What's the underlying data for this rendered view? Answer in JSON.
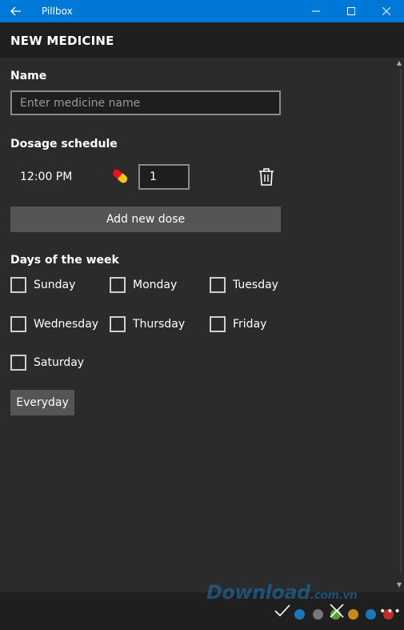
{
  "window": {
    "title": "Pillbox",
    "back_icon": "back-arrow-icon",
    "minimize_icon": "minimize-icon",
    "maximize_icon": "maximize-icon",
    "close_icon": "close-icon",
    "accent_color": "#0078d7"
  },
  "page": {
    "title": "NEW MEDICINE"
  },
  "name_section": {
    "label": "Name",
    "input_value": "",
    "placeholder": "Enter medicine name"
  },
  "dosage_section": {
    "label": "Dosage schedule",
    "doses": [
      {
        "time": "12:00 PM",
        "icon": "pill-icon",
        "quantity": "1",
        "delete_icon": "trash-icon"
      }
    ],
    "add_button": "Add new dose"
  },
  "days_section": {
    "label": "Days of the week",
    "days": [
      {
        "label": "Sunday",
        "checked": false
      },
      {
        "label": "Monday",
        "checked": false
      },
      {
        "label": "Tuesday",
        "checked": false
      },
      {
        "label": "Wednesday",
        "checked": false
      },
      {
        "label": "Thursday",
        "checked": false
      },
      {
        "label": "Friday",
        "checked": false
      },
      {
        "label": "Saturday",
        "checked": false
      }
    ],
    "everyday_button": "Everyday"
  },
  "command_bar": {
    "accept_icon": "checkmark-icon",
    "cancel_icon": "close-icon",
    "more_icon": "more-icon",
    "more_label": "•••"
  },
  "watermark": {
    "text": "Download",
    "suffix": ".com.vn",
    "dot_colors": [
      "#1c77b8",
      "#777777",
      "#5a9e2f",
      "#c98a1a",
      "#1c77b8",
      "#c42b2b"
    ]
  }
}
